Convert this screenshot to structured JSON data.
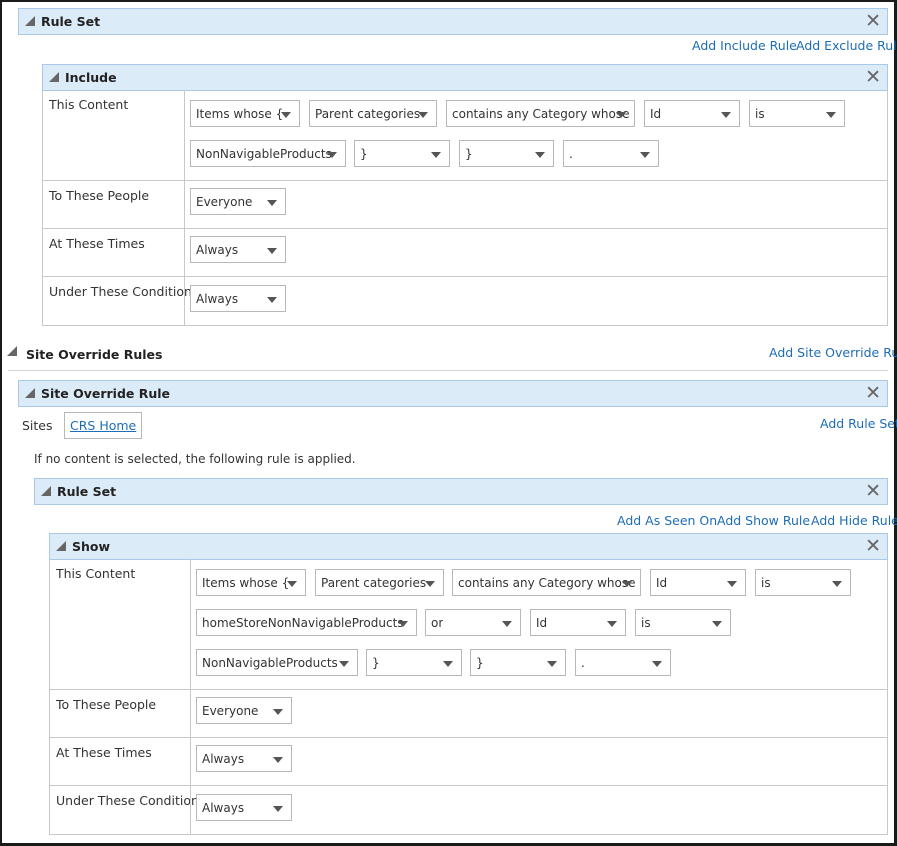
{
  "rule_set_1": {
    "title": "Rule Set",
    "close": "✕",
    "add_include": "Add Include Rule",
    "add_exclude": "Add Exclude Rule",
    "include": {
      "title": "Include",
      "close": "✕",
      "rows": {
        "content_label": "This Content",
        "people_label": "To These People",
        "times_label": "At These Times",
        "conditions_label": "Under These Conditions"
      },
      "content_selects": [
        "Items whose {",
        "Parent categories",
        "contains any Category whose",
        "Id",
        "is",
        "NonNavigableProducts",
        "}",
        "}",
        "."
      ],
      "people_value": "Everyone",
      "times_value": "Always",
      "conditions_value": "Always"
    }
  },
  "site_override": {
    "title": "Site Override Rules",
    "add_site_override": "Add Site Override Rule",
    "rule": {
      "title": "Site Override Rule",
      "close": "✕",
      "sites_label": "Sites",
      "site_button": "CRS Home",
      "add_rule_set": "Add Rule Set",
      "info_text": "If no content is selected, the following rule is applied."
    }
  },
  "rule_set_2": {
    "title": "Rule Set",
    "close": "✕",
    "add_as_seen_on": "Add As Seen On",
    "add_show": "Add Show Rule",
    "add_hide": "Add Hide Rule",
    "show": {
      "title": "Show",
      "close": "✕",
      "rows": {
        "content_label": "This Content",
        "people_label": "To These People",
        "times_label": "At These Times",
        "conditions_label": "Under These Conditions"
      },
      "content_selects": [
        "Items whose {",
        "Parent categories",
        "contains any Category whose",
        "Id",
        "is",
        "homeStoreNonNavigableProducts",
        "or",
        "Id",
        "is",
        "NonNavigableProducts",
        "}",
        "}",
        "."
      ],
      "people_value": "Everyone",
      "times_value": "Always",
      "conditions_value": "Always"
    }
  }
}
